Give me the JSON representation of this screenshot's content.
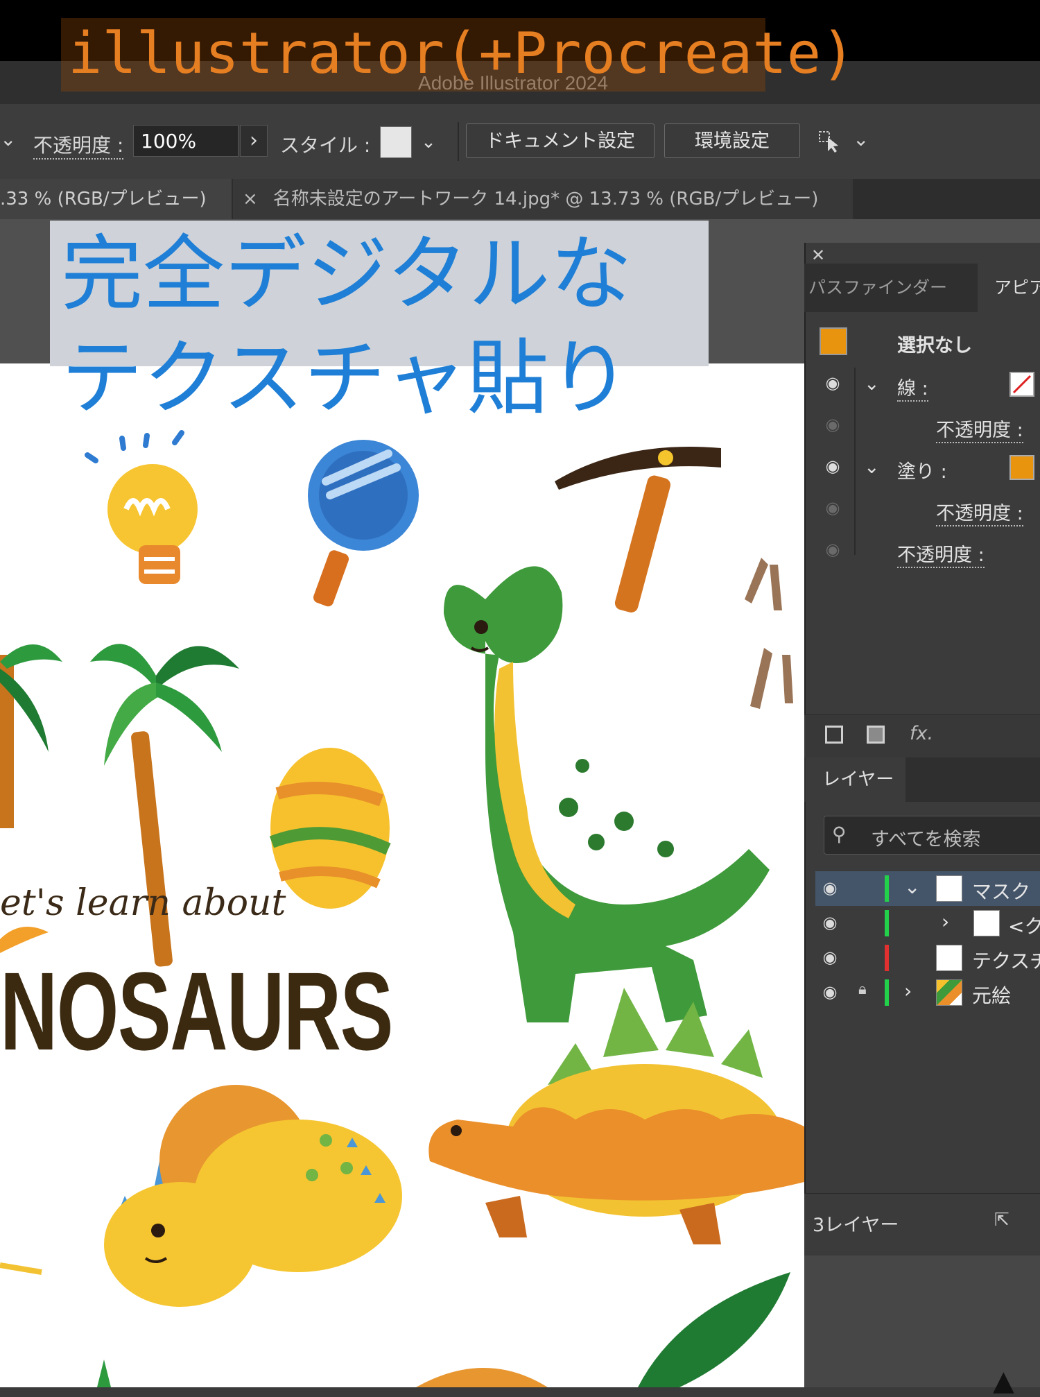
{
  "overlay_title": "illustrator(+Procreate)",
  "app_title": "Adobe Illustrator 2024",
  "control_bar": {
    "opacity_label": "不透明度 :",
    "opacity_value": "100%",
    "style_label": "スタイル :",
    "doc_settings_button": "ドキュメント設定",
    "preferences_button": "環境設定"
  },
  "tabs": [
    {
      "label": ".33 % (RGB/プレビュー)"
    },
    {
      "label": "名称未設定のアートワーク 14.jpg* @ 13.73 % (RGB/プレビュー)"
    }
  ],
  "caption": {
    "line1": "完全デジタルな",
    "line2": "テクスチャ貼り"
  },
  "artwork_text": {
    "lets_learn": "et's learn about",
    "dinosaurs": "NOSAURS"
  },
  "appearance_panel": {
    "tab_pathfinder": "パスファインダー",
    "tab_appearance": "アピア",
    "selection": "選択なし",
    "stroke_label": "線 :",
    "opacity_label": "不透明度 :",
    "fill_label": "塗り :",
    "fx_label": "fx.",
    "fill_color": "#E8940F"
  },
  "layers_panel": {
    "tab": "レイヤー",
    "search_placeholder": "すべてを検索",
    "layers": [
      {
        "name": "マスク",
        "color": "#22D04A",
        "expanded": true
      },
      {
        "name": "<ク",
        "color": "#22D04A",
        "expanded": false
      },
      {
        "name": "テクスチ",
        "color": "#E03030",
        "expanded": false
      },
      {
        "name": "元絵",
        "color": "#22D04A",
        "expanded": false,
        "locked": true
      }
    ],
    "layer_count": "3レイヤー"
  }
}
